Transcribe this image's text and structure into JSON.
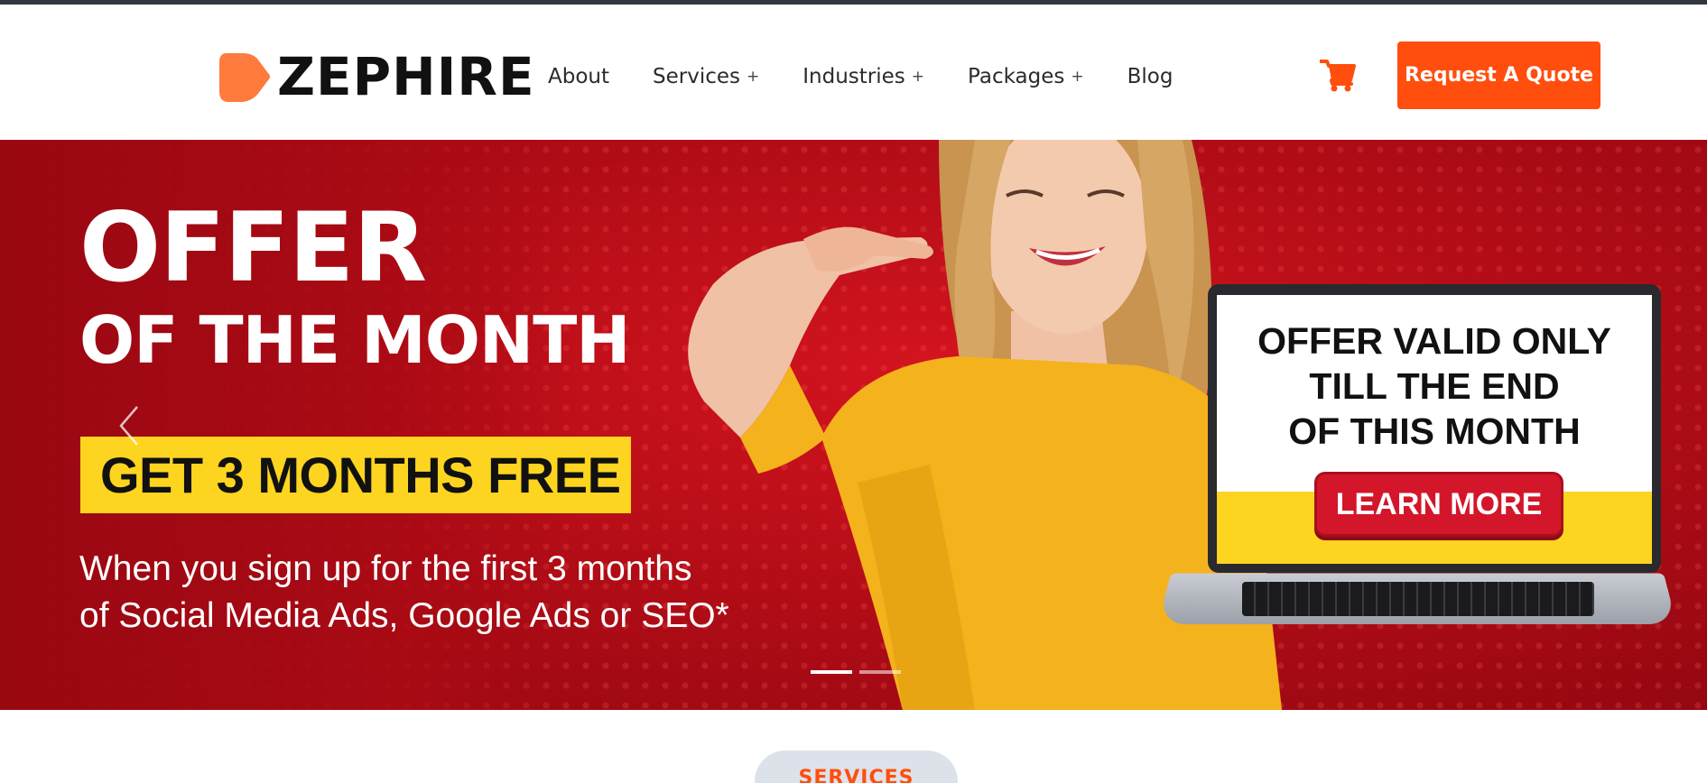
{
  "header": {
    "logo_text": "ZEPHIRE",
    "nav": [
      {
        "label": "About",
        "has_submenu": false
      },
      {
        "label": "Services",
        "has_submenu": true
      },
      {
        "label": "Industries",
        "has_submenu": true
      },
      {
        "label": "Packages",
        "has_submenu": true
      },
      {
        "label": "Blog",
        "has_submenu": false
      }
    ],
    "submenu_marker": "+",
    "cta_label": "Request A Quote",
    "accent_color": "#ff4e0d"
  },
  "hero": {
    "headline_line1": "OFFER",
    "headline_line2": "OF THE MONTH",
    "highlight": "GET 3 MONTHS FREE",
    "subtext_line1": "When you sign up for the first 3 months",
    "subtext_line2": "of Social Media Ads, Google Ads or SEO*",
    "screen_line1": "OFFER VALID ONLY",
    "screen_line2": "TILL THE END",
    "screen_line3": "OF THIS MONTH",
    "learn_more": "LEARN MORE",
    "slides_total": 2,
    "active_slide": 1,
    "background_color": "#b40d17",
    "highlight_color": "#fdd41f"
  },
  "services": {
    "label": "SERVICES"
  }
}
